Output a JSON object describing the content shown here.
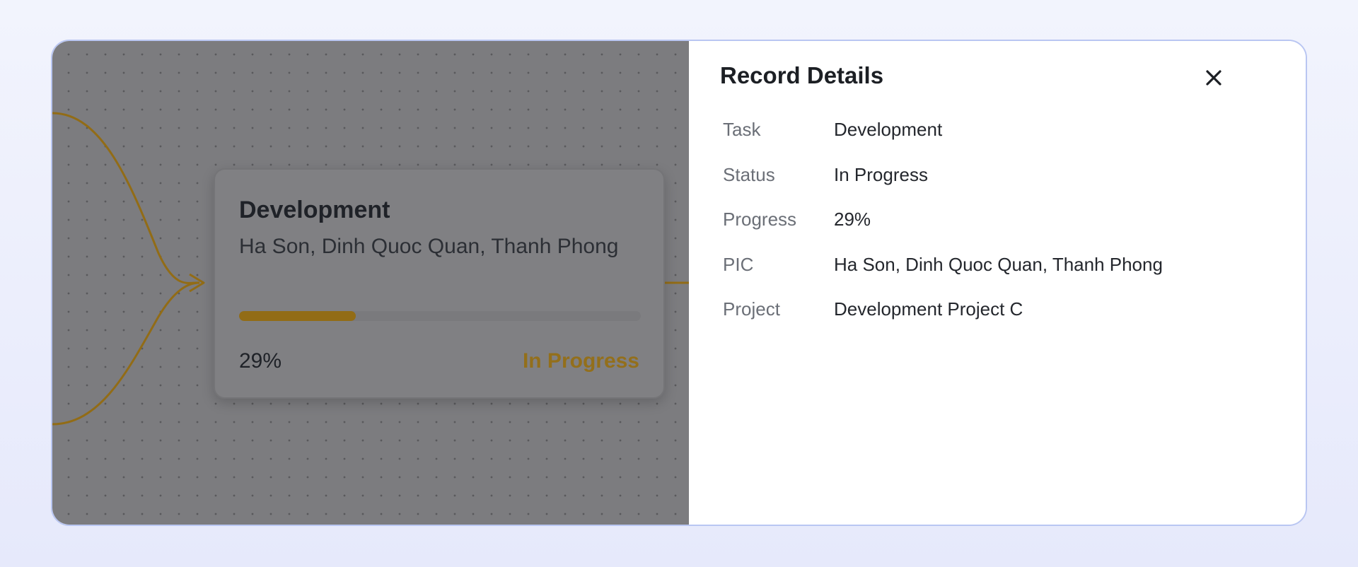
{
  "node": {
    "title": "Development",
    "pic": "Ha Son, Dinh Quoc Quan, Thanh Phong",
    "progress_fraction": 0.29,
    "progress_text": "29%",
    "status": "In Progress"
  },
  "panel": {
    "title": "Record Details",
    "close_icon": "close-icon",
    "fields": [
      {
        "label": "Task",
        "value": "Development"
      },
      {
        "label": "Status",
        "value": "In Progress"
      },
      {
        "label": "Progress",
        "value": "29%"
      },
      {
        "label": "PIC",
        "value": "Ha Son, Dinh Quoc Quan, Thanh Phong"
      },
      {
        "label": "Project",
        "value": "Development Project C"
      }
    ]
  },
  "colors": {
    "accent": "#926c16",
    "overlay": "#7c7c7f",
    "frame_border": "#b9c6f2"
  }
}
